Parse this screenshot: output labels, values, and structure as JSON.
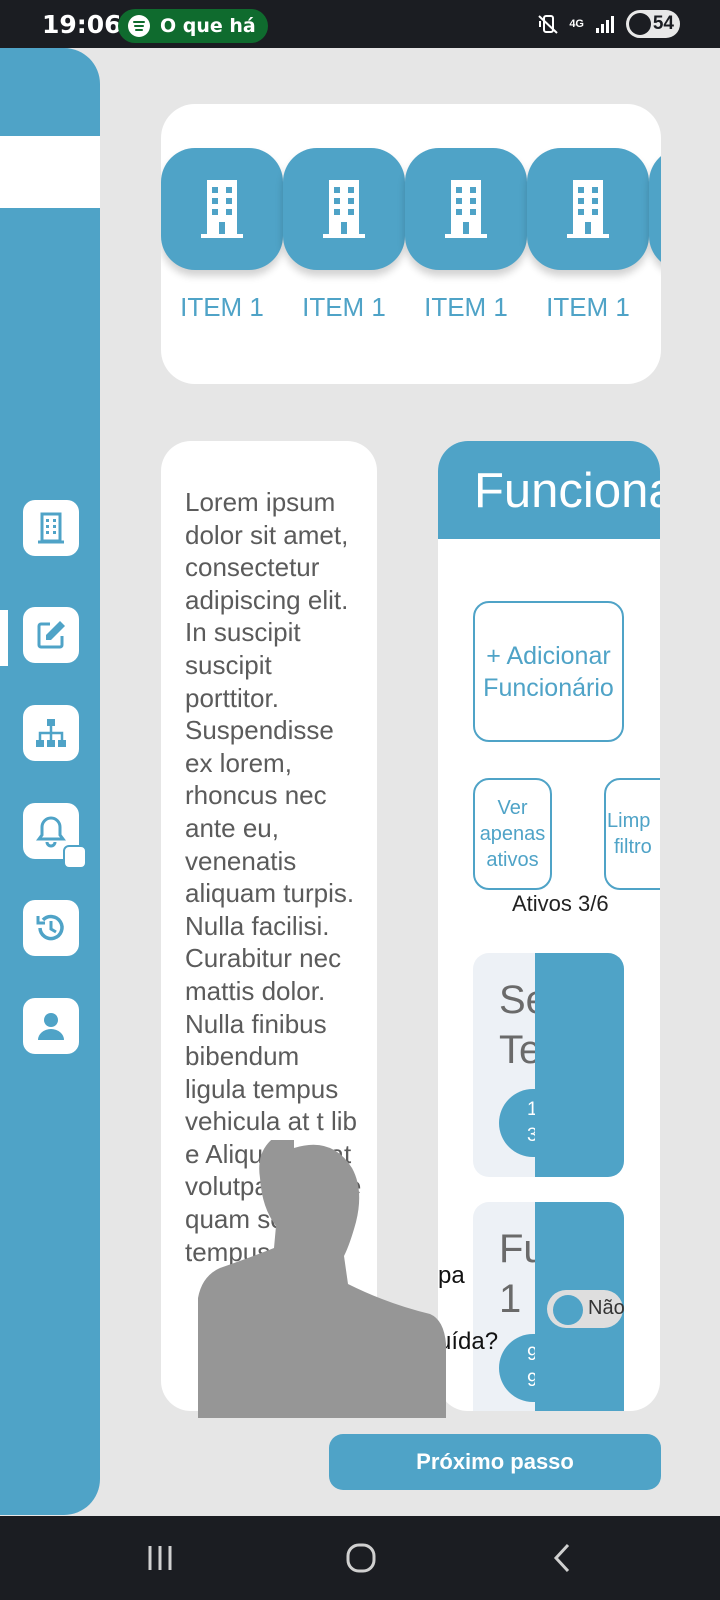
{
  "status_bar": {
    "time": "19:06",
    "media_pill_text": "O que há",
    "network": "4G",
    "battery": "54"
  },
  "colors": {
    "primary": "#4fa3c7",
    "background": "#e6e6e6",
    "card": "#ffffff",
    "system_bar": "#1b1d22"
  },
  "sidebar": {
    "items": [
      {
        "icon": "building-icon"
      },
      {
        "icon": "edit-icon",
        "active": true
      },
      {
        "icon": "org-chart-icon"
      },
      {
        "icon": "bell-report-icon"
      },
      {
        "icon": "history-icon"
      },
      {
        "icon": "user-icon"
      }
    ]
  },
  "carousel": {
    "items": [
      {
        "label": "ITEM 1",
        "icon": "building-icon"
      },
      {
        "label": "ITEM 1",
        "icon": "building-icon"
      },
      {
        "label": "ITEM 1",
        "icon": "building-icon"
      },
      {
        "label": "ITEM 1",
        "icon": "building-icon"
      }
    ]
  },
  "description": {
    "text": "Lorem ipsum dolor sit amet, consectetur adipiscing elit. In suscipit suscipit porttitor. Suspendisse ex lorem, rhoncus nec ante eu, venenatis aliquam turpis. Nulla facilisi. Curabitur nec mattis dolor. Nulla finibus bibendum ligula tempus vehicula at t lib e Aliquam erat volutpat. Fusce quam sem tempus"
  },
  "employees": {
    "title": "Funciona",
    "add_button_line1": "+ Adicionar",
    "add_button_line2": "Funcionário",
    "filter_active_line1": "Ver",
    "filter_active_line2": "apenas",
    "filter_active_line3": "ativos",
    "clear_filter_line1": "Limp",
    "clear_filter_line2": "filtro",
    "active_count": "Ativos 3/6",
    "rows": [
      {
        "name_line1": "Se",
        "name_line2": "Te",
        "pill_line1": "1",
        "pill_line2": "3",
        "menu": "•••"
      },
      {
        "name_line1": "Fu",
        "name_line2": "1",
        "pill_line1": "9",
        "pill_line2": "9",
        "toggle_label": "Não"
      }
    ]
  },
  "dialog_fragments": {
    "line1": "pa",
    "line2": "uída?"
  },
  "next_button": "Próximo passo"
}
